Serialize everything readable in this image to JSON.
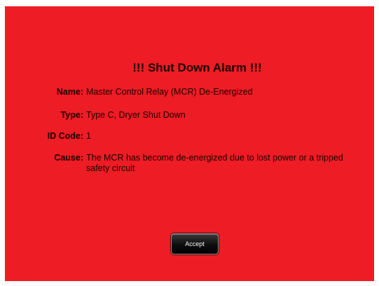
{
  "alarm": {
    "title": "!!! Shut Down Alarm !!!",
    "fields": [
      {
        "label": "Name:",
        "value": "Master Control Relay (MCR) De-Energized"
      },
      {
        "label": "Type:",
        "value": "Type C, Dryer Shut Down"
      },
      {
        "label": "ID Code:",
        "value": "1"
      },
      {
        "label": "Cause:",
        "value": "The MCR has become de-energized due to lost power or a tripped safety circuit"
      }
    ]
  },
  "buttons": {
    "accept_label": "Accept"
  },
  "colors": {
    "background": "#ee1c24",
    "button": "#000000"
  }
}
